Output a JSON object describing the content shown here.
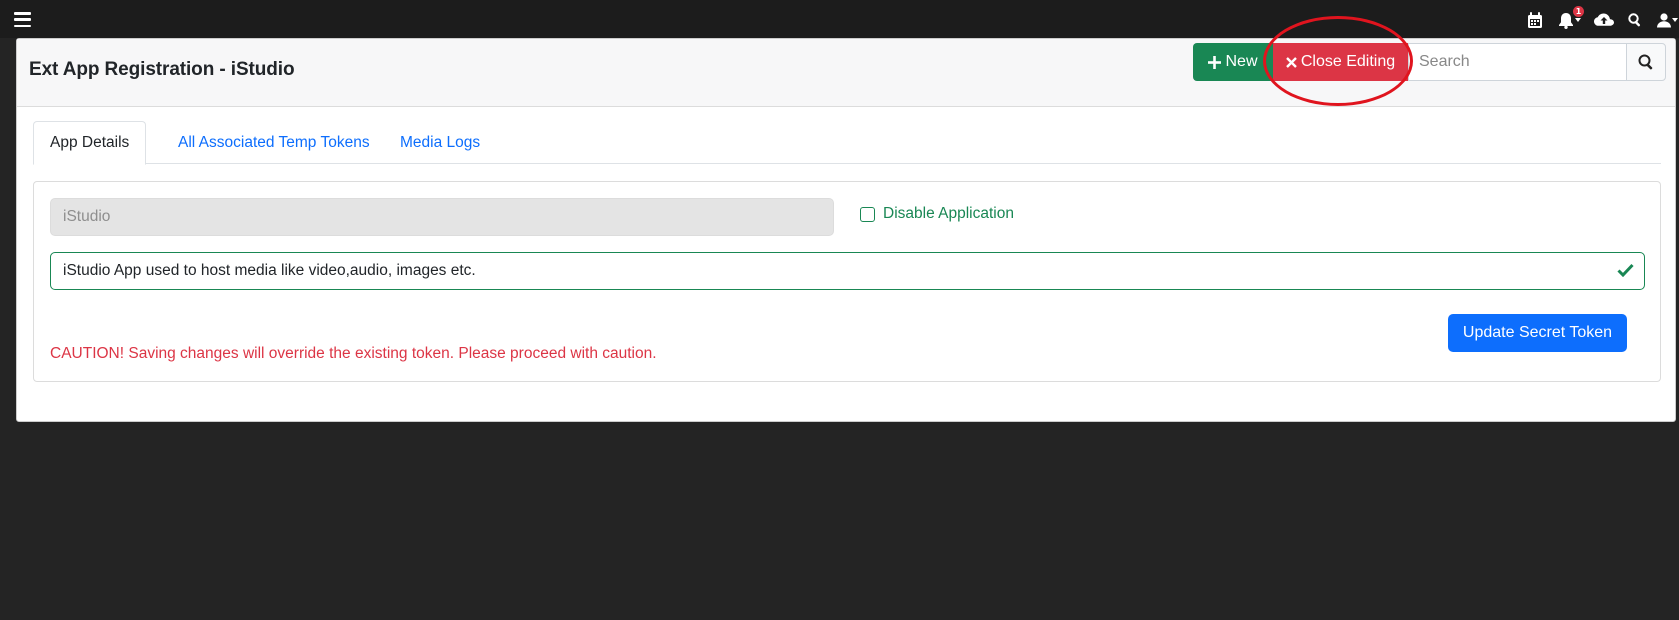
{
  "topbar": {
    "notification_count": "1",
    "icons": [
      "menu-icon",
      "calendar-icon",
      "bell-icon",
      "cloud-upload-icon",
      "search-icon",
      "user-icon"
    ]
  },
  "header": {
    "title": "Ext App Registration - iStudio",
    "new_label": "New",
    "close_editing_label": "Close Editing",
    "search_placeholder": "Search"
  },
  "tabs": [
    {
      "label": "App Details",
      "active": true
    },
    {
      "label": "All Associated Temp Tokens",
      "active": false
    },
    {
      "label": "Media Logs",
      "active": false
    }
  ],
  "form": {
    "app_name": "iStudio",
    "disable_label": "Disable Application",
    "disable_checked": false,
    "description": "iStudio App used to host media like video,audio, images etc.",
    "update_token_label": "Update Secret Token",
    "caution_text": "CAUTION! Saving changes will override the existing token. Please proceed with caution."
  },
  "colors": {
    "primary": "#0d6efd",
    "success": "#198754",
    "danger": "#dc3545",
    "annotation": "#e0141e"
  }
}
